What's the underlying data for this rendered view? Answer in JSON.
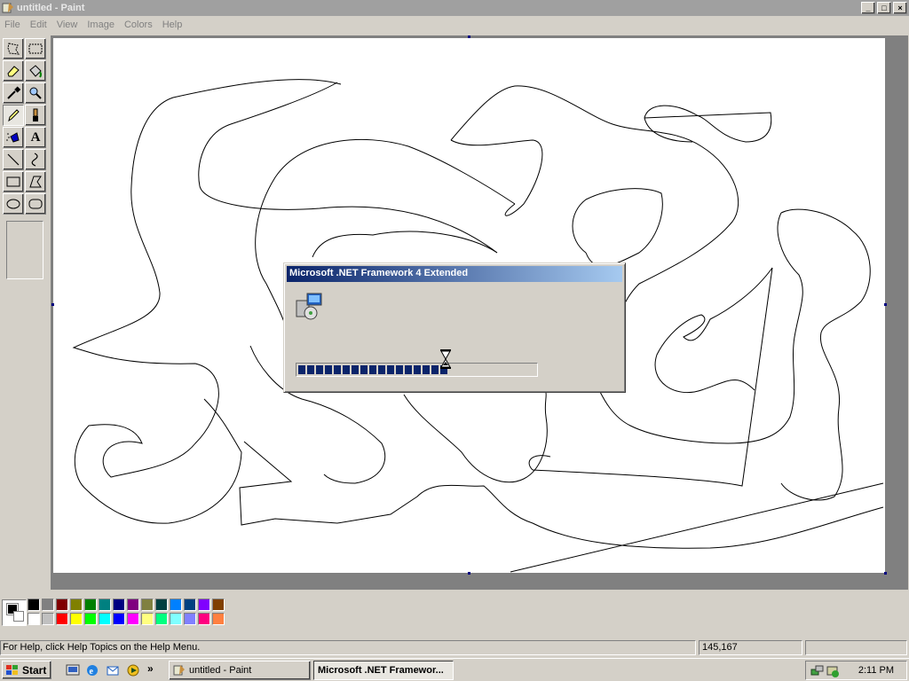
{
  "window": {
    "title": "untitled - Paint",
    "controls": [
      "_",
      "□",
      "×"
    ]
  },
  "menu": [
    "File",
    "Edit",
    "View",
    "Image",
    "Colors",
    "Help"
  ],
  "tools": [
    {
      "name": "free-form-select",
      "icon": "free-select-icon"
    },
    {
      "name": "rectangle-select",
      "icon": "select-icon"
    },
    {
      "name": "eraser",
      "icon": "eraser-icon"
    },
    {
      "name": "fill-with-color",
      "icon": "fill-icon"
    },
    {
      "name": "pick-color",
      "icon": "eyedropper-icon"
    },
    {
      "name": "magnifier",
      "icon": "magnifier-icon"
    },
    {
      "name": "pencil",
      "icon": "pencil-icon",
      "selected": true
    },
    {
      "name": "brush",
      "icon": "brush-icon"
    },
    {
      "name": "airbrush",
      "icon": "airbrush-icon"
    },
    {
      "name": "text",
      "icon": "text-icon",
      "glyph": "A"
    },
    {
      "name": "line",
      "icon": "line-icon"
    },
    {
      "name": "curve",
      "icon": "curve-icon"
    },
    {
      "name": "rectangle",
      "icon": "rectangle-icon"
    },
    {
      "name": "polygon",
      "icon": "polygon-icon"
    },
    {
      "name": "ellipse",
      "icon": "ellipse-icon"
    },
    {
      "name": "rounded-rectangle",
      "icon": "rounded-rectangle-icon"
    }
  ],
  "palette": {
    "foreground": "#000000",
    "background": "#ffffff",
    "top_row": [
      "#000000",
      "#808080",
      "#800000",
      "#808000",
      "#008000",
      "#008080",
      "#000080",
      "#800080",
      "#808040",
      "#004040",
      "#0080ff",
      "#004080",
      "#8000ff",
      "#804000"
    ],
    "bottom_row": [
      "#ffffff",
      "#c0c0c0",
      "#ff0000",
      "#ffff00",
      "#00ff00",
      "#00ffff",
      "#0000ff",
      "#ff00ff",
      "#ffff80",
      "#00ff80",
      "#80ffff",
      "#8080ff",
      "#ff0080",
      "#ff8040"
    ]
  },
  "status": {
    "help_text": "For Help, click Help Topics on the Help Menu.",
    "coords": "145,167",
    "size": ""
  },
  "dialog": {
    "title": "Microsoft .NET Framework 4 Extended",
    "progress_fraction": 0.62,
    "accent_color": "#0a246a"
  },
  "taskbar": {
    "start_label": "Start",
    "quick_launch": [
      "show-desktop-icon",
      "internet-explorer-icon",
      "outlook-express-icon",
      "windows-media-icon"
    ],
    "more_symbol": "»",
    "tasks": [
      {
        "label": "untitled - Paint",
        "active": false
      },
      {
        "label": "Microsoft .NET Framewor...",
        "active": true
      }
    ],
    "clock": "2:11 PM"
  }
}
